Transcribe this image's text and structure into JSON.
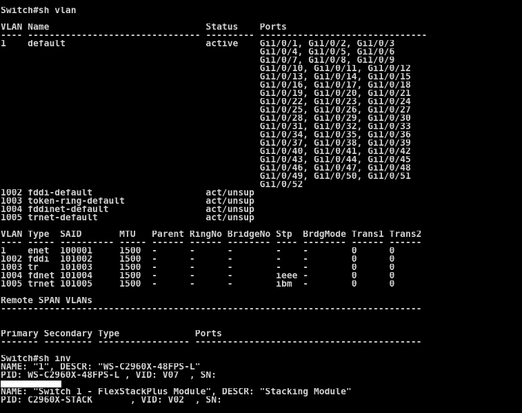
{
  "terminal": {
    "colors": {
      "background": "#000000",
      "foreground": "#d0d0d0",
      "redaction": "#ffffff"
    },
    "lines": [
      "Switch#sh vlan",
      "",
      "VLAN Name                             Status    Ports",
      "---- -------------------------------- --------- -------------------------------",
      "1    default                          active    Gi1/0/1, Gi1/0/2, Gi1/0/3",
      "                                                Gi1/0/4, Gi1/0/5, Gi1/0/6",
      "                                                Gi1/0/7, Gi1/0/8, Gi1/0/9",
      "                                                Gi1/0/10, Gi1/0/11, Gi1/0/12",
      "                                                Gi1/0/13, Gi1/0/14, Gi1/0/15",
      "                                                Gi1/0/16, Gi1/0/17, Gi1/0/18",
      "                                                Gi1/0/19, Gi1/0/20, Gi1/0/21",
      "                                                Gi1/0/22, Gi1/0/23, Gi1/0/24",
      "                                                Gi1/0/25, Gi1/0/26, Gi1/0/27",
      "                                                Gi1/0/28, Gi1/0/29, Gi1/0/30",
      "                                                Gi1/0/31, Gi1/0/32, Gi1/0/33",
      "                                                Gi1/0/34, Gi1/0/35, Gi1/0/36",
      "                                                Gi1/0/37, Gi1/0/38, Gi1/0/39",
      "                                                Gi1/0/40, Gi1/0/41, Gi1/0/42",
      "                                                Gi1/0/43, Gi1/0/44, Gi1/0/45",
      "                                                Gi1/0/46, Gi1/0/47, Gi1/0/48",
      "                                                Gi1/0/49, Gi1/0/50, Gi1/0/51",
      "                                                Gi1/0/52",
      "1002 fddi-default                     act/unsup",
      "1003 token-ring-default               act/unsup",
      "1004 fddinet-default                  act/unsup",
      "1005 trnet-default                    act/unsup",
      "",
      "VLAN Type  SAID       MTU   Parent RingNo BridgeNo Stp  BrdgMode Trans1 Trans2",
      "---- ----- ---------- ----- ------ ------ -------- ---- -------- ------ ------",
      "1    enet  100001     1500  -      -      -        -    -        0      0",
      "1002 fddi  101002     1500  -      -      -        -    -        0      0",
      "1003 tr    101003     1500  -      -      -        -    -        0      0",
      "1004 fdnet 101004     1500  -      -      -        ieee -        0      0",
      "1005 trnet 101005     1500  -      -      -        ibm  -        0      0",
      "",
      "Remote SPAN VLANs",
      "------------------------------------------------------------------------------",
      "",
      "",
      "Primary Secondary Type              Ports",
      "------- --------- ----------------- ------------------------------------------",
      "",
      "Switch#sh inv",
      "NAME: \"1\", DESCR: \"WS-C2960X-48FPS-L\"",
      "PID: WS-C2960X-48FPS-L , VID: V07  , SN: ",
      "",
      "NAME: \"Switch 1 - FlexStackPlus Module\", DESCR: \"Stacking Module\"",
      "PID: C2960X-STACK       , VID: V02  , SN: "
    ],
    "redacted_lines": [
      45,
      48
    ]
  }
}
